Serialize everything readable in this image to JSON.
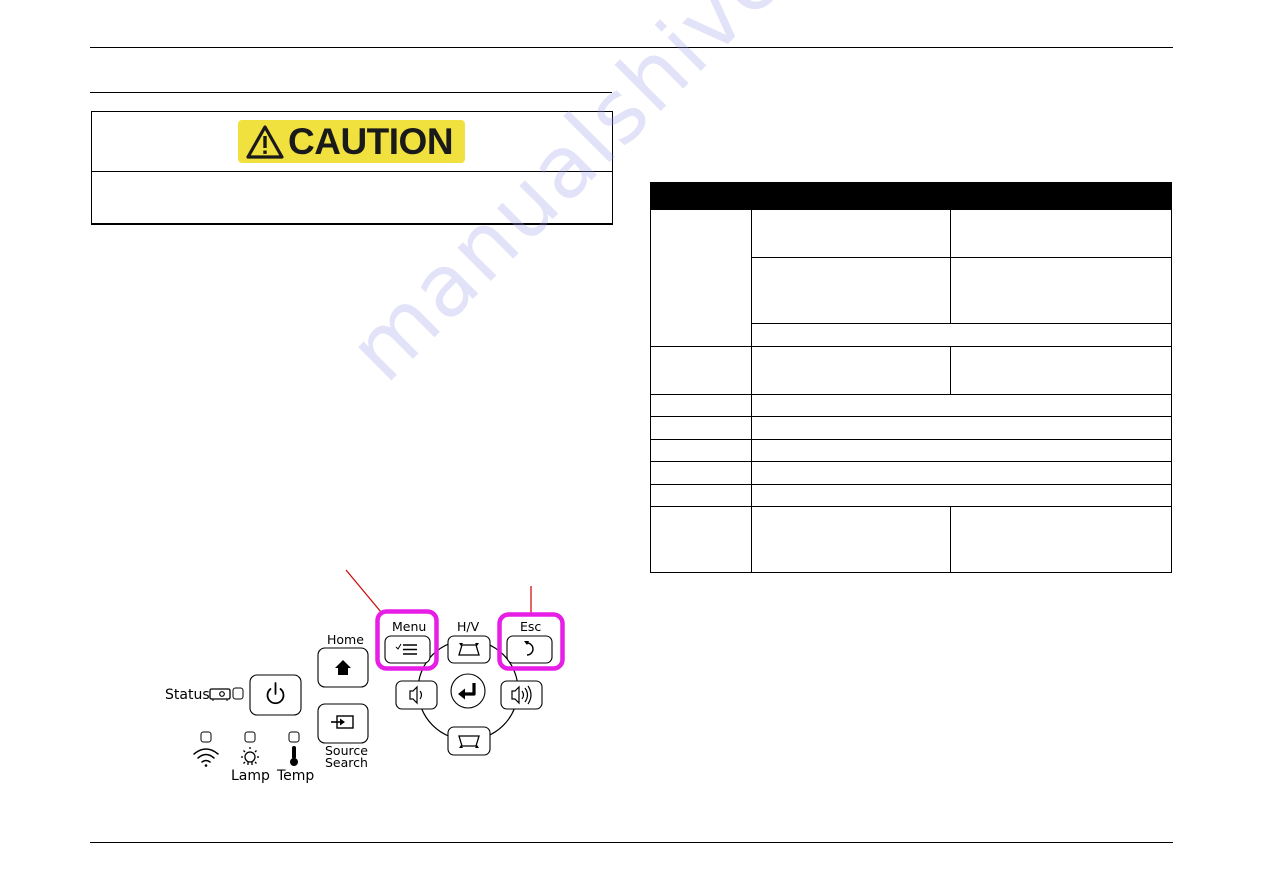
{
  "caution": {
    "label": "CAUTION",
    "body_text": "",
    "colors": {
      "label_bg": "#f0e13f",
      "label_text": "#1a1a1a"
    }
  },
  "spec_table": {
    "headers": [
      "",
      ""
    ],
    "rows": [
      [
        "",
        "",
        ""
      ],
      [
        "",
        ""
      ],
      [
        ""
      ],
      [
        "",
        "",
        ""
      ],
      [
        "",
        ""
      ],
      [
        "",
        ""
      ],
      [
        "",
        ""
      ],
      [
        "",
        ""
      ],
      [
        "",
        ""
      ],
      [
        "",
        "",
        ""
      ]
    ]
  },
  "control_panel": {
    "labels": {
      "status": "Status",
      "home": "Home",
      "source_search_line1": "Source",
      "source_search_line2": "Search",
      "lamp": "Lamp",
      "temp": "Temp",
      "menu": "Menu",
      "hv": "H/V",
      "esc": "Esc"
    },
    "icons": {
      "power": "power-icon",
      "home": "home-icon",
      "source": "source-input-icon",
      "menu": "menu-list-icon",
      "hv_keystone": "keystone-up-icon",
      "keystone_down": "keystone-down-icon",
      "esc": "return-arrow-icon",
      "enter": "enter-icon",
      "volume_down": "volume-down-icon",
      "volume_up": "volume-up-icon",
      "wifi": "wifi-icon",
      "lamp": "lamp-icon",
      "temp": "thermometer-icon",
      "projector": "projector-icon"
    },
    "highlight_color": "#e61ee6",
    "callout_color": "#cc0000"
  },
  "watermark": "manualshive.com"
}
